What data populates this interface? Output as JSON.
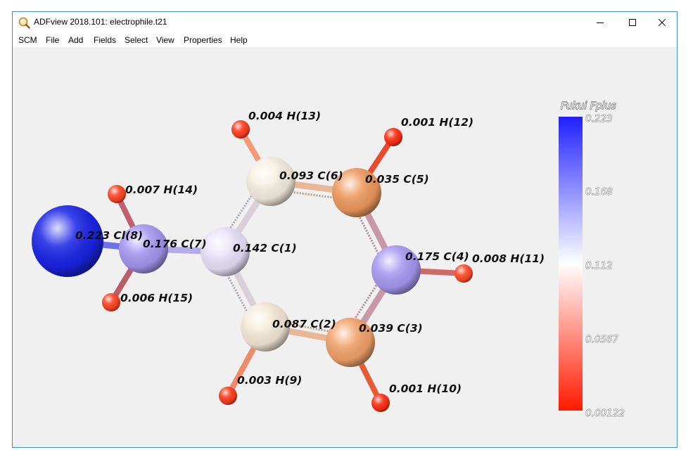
{
  "window": {
    "title": "ADFview 2018.101: electrophile.t21"
  },
  "menu": [
    {
      "label": "SCM"
    },
    {
      "label": "File"
    },
    {
      "label": "Add"
    },
    {
      "label": "Fields"
    },
    {
      "label": "Select"
    },
    {
      "label": "View"
    },
    {
      "label": "Properties"
    },
    {
      "label": "Help"
    }
  ],
  "colorbar": {
    "title": "Fukui Fplus",
    "ticks": [
      "0.223",
      "0.168",
      "0.112",
      "0.0567",
      "0.00122"
    ],
    "colors": {
      "max": "#2020ff",
      "mid": "#ffffff",
      "min": "#ff1a00"
    }
  },
  "atoms": [
    {
      "id": "C1",
      "label": "0.142 C(1)",
      "value": 0.142,
      "color": "#e9e3fb"
    },
    {
      "id": "C2",
      "label": "0.087 C(2)",
      "value": 0.087,
      "color": "#f6ead9"
    },
    {
      "id": "C3",
      "label": "0.039 C(3)",
      "value": 0.039,
      "color": "#f2a36a"
    },
    {
      "id": "C4",
      "label": "0.175 C(4)",
      "value": 0.175,
      "color": "#a89af3"
    },
    {
      "id": "C5",
      "label": "0.035 C(5)",
      "value": 0.035,
      "color": "#ef9a5e"
    },
    {
      "id": "C6",
      "label": "0.093 C(6)",
      "value": 0.093,
      "color": "#f7efe2"
    },
    {
      "id": "C7",
      "label": "0.176 C(7)",
      "value": 0.176,
      "color": "#a698f3"
    },
    {
      "id": "Cl8",
      "label": "0.223 Cl(8)",
      "value": 0.223,
      "color": "#1a24e6"
    },
    {
      "id": "H9",
      "label": "0.003 H(9)",
      "value": 0.003,
      "color": "#ff3a1a"
    },
    {
      "id": "H10",
      "label": "0.001 H(10)",
      "value": 0.001,
      "color": "#ff2d10"
    },
    {
      "id": "H11",
      "label": "0.008 H(11)",
      "value": 0.008,
      "color": "#ff4a26"
    },
    {
      "id": "H12",
      "label": "0.001 H(12)",
      "value": 0.001,
      "color": "#ff2d10"
    },
    {
      "id": "H13",
      "label": "0.004 H(13)",
      "value": 0.004,
      "color": "#ff3d1c"
    },
    {
      "id": "H14",
      "label": "0.007 H(14)",
      "value": 0.007,
      "color": "#ff4524"
    },
    {
      "id": "H15",
      "label": "0.006 H(15)",
      "value": 0.006,
      "color": "#ff4220"
    }
  ]
}
